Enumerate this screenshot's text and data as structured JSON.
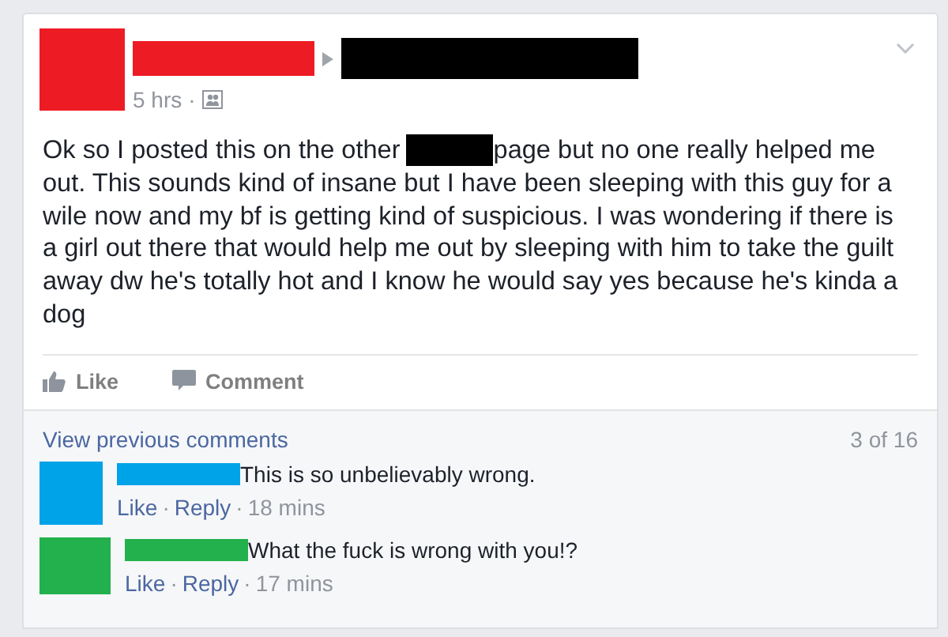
{
  "post": {
    "time": "5 hrs",
    "separator": "·",
    "first_line_before": "Ok so I posted this on the other",
    "first_line_after": "page but no one really helped me",
    "more_lines": [
      "out. This sounds kind of insane but I have been sleeping with this guy for a",
      "wile now and my bf is getting kind of suspicious. I was wondering if there is",
      "a girl out there that would help me out by sleeping with him to take the guilt",
      "away dw he's totally hot and I know he would say yes because he's kinda a",
      "dog"
    ]
  },
  "actions": [
    "Like",
    "Comment"
  ],
  "comments_header": {
    "link": "View previous comments",
    "count": "3 of 16"
  },
  "comments": [
    {
      "color": "#00a2e8",
      "text": "This is so unbelievably wrong.",
      "like": "Like",
      "sep_1": "·",
      "reply": "Reply",
      "sep_2": "·",
      "time": "18 mins"
    },
    {
      "color": "#22b14c",
      "text": "What the fuck is wrong with you!?",
      "like": "Like",
      "sep_1": "·",
      "reply": "Reply",
      "sep_2": "·",
      "time": "17 mins"
    }
  ]
}
